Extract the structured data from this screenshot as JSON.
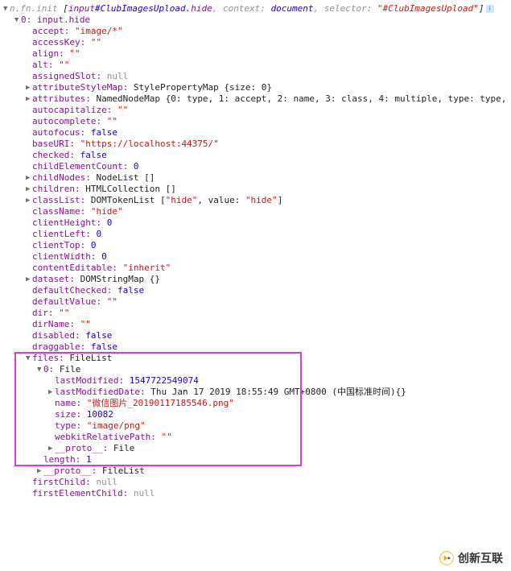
{
  "root": {
    "prefix": "n.fn.init",
    "bracket_open": "[",
    "el_tag": "input",
    "el_id": "#ClubImagesUpload",
    "el_class": ".hide",
    "context_label": "context:",
    "context_val": "document",
    "selector_label": "selector:",
    "selector_val": "\"#ClubImagesUpload\"",
    "bracket_close": "]"
  },
  "idx0": {
    "key": "0:",
    "tag": "input",
    "cls": ".hide"
  },
  "props": {
    "accept": {
      "k": "accept:",
      "v": "\"image/*\""
    },
    "accessKey": {
      "k": "accessKey:",
      "v": "\"\""
    },
    "align": {
      "k": "align:",
      "v": "\"\""
    },
    "alt": {
      "k": "alt:",
      "v": "\"\""
    },
    "assignedSlot": {
      "k": "assignedSlot:",
      "v": "null"
    },
    "attributeStyleMap": {
      "k": "attributeStyleMap:",
      "v": "StylePropertyMap {size: 0}"
    },
    "attributes": {
      "k": "attributes:",
      "v": "NamedNodeMap {0: type, 1: accept, 2: name, 3: class, 4: multiple, type: type,"
    },
    "autocapitalize": {
      "k": "autocapitalize:",
      "v": "\"\""
    },
    "autocomplete": {
      "k": "autocomplete:",
      "v": "\"\""
    },
    "autofocus": {
      "k": "autofocus:",
      "v": "false"
    },
    "baseURI": {
      "k": "baseURI:",
      "v": "\"https://localhost:44375/\""
    },
    "checked": {
      "k": "checked:",
      "v": "false"
    },
    "childElementCount": {
      "k": "childElementCount:",
      "v": "0"
    },
    "childNodes": {
      "k": "childNodes:",
      "v": "NodeList []"
    },
    "children": {
      "k": "children:",
      "v": "HTMLCollection []"
    },
    "classList": {
      "k": "classList:",
      "v_pre": "DOMTokenList [",
      "v_str": "\"hide\"",
      "v_mid": ", value: ",
      "v_str2": "\"hide\"",
      "v_post": "]"
    },
    "className": {
      "k": "className:",
      "v": "\"hide\""
    },
    "clientHeight": {
      "k": "clientHeight:",
      "v": "0"
    },
    "clientLeft": {
      "k": "clientLeft:",
      "v": "0"
    },
    "clientTop": {
      "k": "clientTop:",
      "v": "0"
    },
    "clientWidth": {
      "k": "clientWidth:",
      "v": "0"
    },
    "contentEditable": {
      "k": "contentEditable:",
      "v": "\"inherit\""
    },
    "dataset": {
      "k": "dataset:",
      "v": "DOMStringMap {}"
    },
    "defaultChecked": {
      "k": "defaultChecked:",
      "v": "false"
    },
    "defaultValue": {
      "k": "defaultValue:",
      "v": "\"\""
    },
    "dir": {
      "k": "dir:",
      "v": "\"\""
    },
    "dirName": {
      "k": "dirName:",
      "v": "\"\""
    },
    "disabled": {
      "k": "disabled:",
      "v": "false"
    },
    "draggable": {
      "k": "draggable:",
      "v": "false"
    },
    "files": {
      "k": "files:",
      "v": "FileList"
    },
    "proto_filelist": {
      "k": "__proto__:",
      "v": "FileList"
    },
    "firstChild": {
      "k": "firstChild:",
      "v": "null"
    },
    "firstElementChild": {
      "k": "firstElementChild:",
      "v": "null"
    }
  },
  "file0": {
    "key": "0:",
    "ftype": "File",
    "lastModified": {
      "k": "lastModified:",
      "v": "1547722549074"
    },
    "lastModifiedDate": {
      "k": "lastModifiedDate:",
      "v": "Thu Jan 17 2019 18:55:49 GMT+0800 (中国标准时间){}"
    },
    "name": {
      "k": "name:",
      "v": "\"微信图片_20190117185546.png\""
    },
    "size": {
      "k": "size:",
      "v": "10082"
    },
    "type": {
      "k": "type:",
      "v": "\"image/png\""
    },
    "webkitRelativePath": {
      "k": "webkitRelativePath:",
      "v": "\"\""
    },
    "proto": {
      "k": "__proto__:",
      "v": "File"
    },
    "length": {
      "k": "length:",
      "v": "1"
    }
  },
  "watermark": "创新互联"
}
